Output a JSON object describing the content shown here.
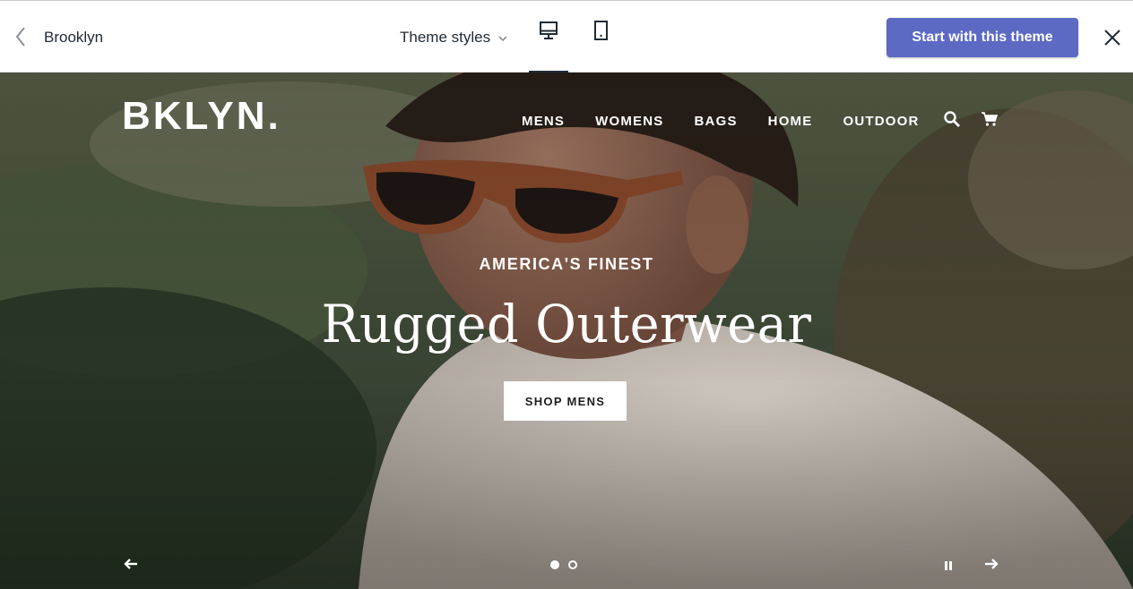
{
  "topbar": {
    "theme_name": "Brooklyn",
    "styles_label": "Theme styles",
    "cta_label": "Start with this theme",
    "active_device": "desktop"
  },
  "store": {
    "logo": "BKLYN.",
    "nav": [
      "MENS",
      "WOMENS",
      "BAGS",
      "HOME",
      "OUTDOOR"
    ],
    "icons": [
      "search-icon",
      "cart-icon"
    ]
  },
  "hero": {
    "eyebrow": "AMERICA'S FINEST",
    "headline": "Rugged Outerwear",
    "button_label": "SHOP MENS",
    "slides_total": 2,
    "active_slide": 1
  },
  "colors": {
    "accent": "#5c6ac4",
    "text_dark": "#212b36",
    "hero_overlay_text": "#ffffff"
  }
}
